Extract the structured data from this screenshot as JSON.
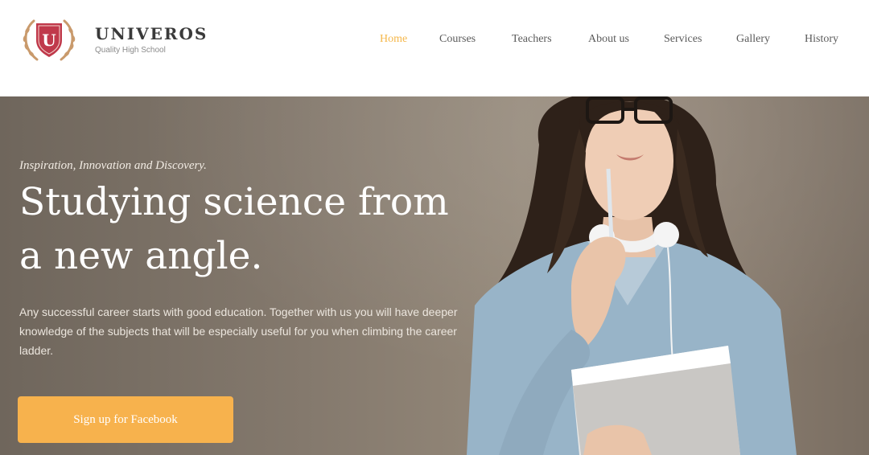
{
  "brand": {
    "name": "UNIVEROS",
    "tagline": "Quality High School",
    "logo_letter": "U"
  },
  "nav": {
    "items": [
      {
        "label": "Home",
        "active": true
      },
      {
        "label": "Courses",
        "active": false
      },
      {
        "label": "Teachers",
        "active": false
      },
      {
        "label": "About us",
        "active": false
      },
      {
        "label": "Services",
        "active": false
      },
      {
        "label": "Gallery",
        "active": false
      },
      {
        "label": "History",
        "active": false
      }
    ]
  },
  "hero": {
    "kicker": "Inspiration, Innovation and Discovery.",
    "headline_line1": "Studying science from",
    "headline_line2": "a new angle.",
    "lede": "Any successful career starts with good education. Together with us you will have deeper knowledge of the subjects that will be especially useful for you when climbing the career ladder.",
    "cta_label": "Sign up for Facebook"
  },
  "colors": {
    "accent": "#f5b74a",
    "button": "#f7b24d",
    "logo_red": "#c0394b",
    "logo_wreath": "#c99a6c",
    "hero_bg": "#84796d"
  }
}
